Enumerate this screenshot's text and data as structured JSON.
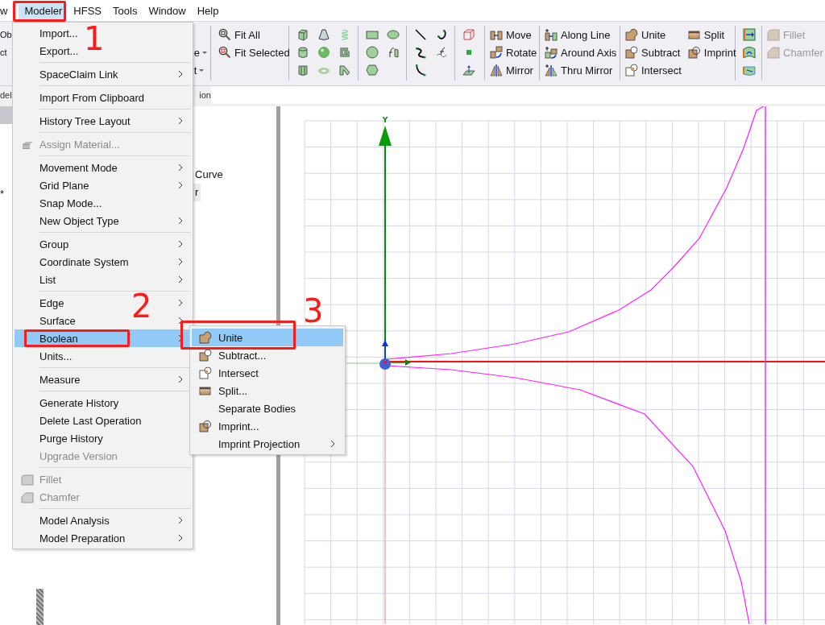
{
  "menubar": [
    {
      "label": "w",
      "selected": false
    },
    {
      "label": "Modeler",
      "selected": true
    },
    {
      "label": "HFSS",
      "selected": false
    },
    {
      "label": "Tools",
      "selected": false
    },
    {
      "label": "Window",
      "selected": false
    },
    {
      "label": "Help",
      "selected": false
    }
  ],
  "ribbon": {
    "cut_left": [
      "Ob",
      "ct"
    ],
    "cut_dropdowns": [
      "e",
      "t"
    ],
    "view": [
      "Fit All",
      "Fit Selected"
    ],
    "transform": [
      "Move",
      "Rotate",
      "Mirror"
    ],
    "duplicate": [
      "Along Line",
      "Around Axis",
      "Thru Mirror"
    ],
    "boolean": [
      "Unite",
      "Subtract",
      "Intersect"
    ],
    "boolean_more": [
      "Split",
      "Imprint"
    ],
    "edges": [
      {
        "label": "Fillet",
        "disabled": true
      },
      {
        "label": "Chamfer",
        "disabled": true
      }
    ]
  },
  "group_labels": [
    "del",
    "ion"
  ],
  "tree": {
    "mark": "*",
    "items": [
      "Curve",
      "r"
    ]
  },
  "menu": {
    "items": [
      {
        "kind": "plain",
        "label": "Import...",
        "submenu": false,
        "disabled": false,
        "selected": false
      },
      {
        "kind": "plain",
        "label": "Export...",
        "submenu": false,
        "disabled": false,
        "selected": false
      },
      {
        "kind": "separator"
      },
      {
        "kind": "plain",
        "label": "SpaceClaim Link",
        "submenu": true,
        "disabled": false,
        "selected": false
      },
      {
        "kind": "separator"
      },
      {
        "kind": "plain",
        "label": "Import From Clipboard",
        "submenu": false,
        "disabled": false,
        "selected": false
      },
      {
        "kind": "separator"
      },
      {
        "kind": "plain",
        "label": "History Tree Layout",
        "submenu": true,
        "disabled": false,
        "selected": false
      },
      {
        "kind": "separator"
      },
      {
        "kind": "material",
        "label": "Assign Material...",
        "submenu": false,
        "disabled": true,
        "selected": false
      },
      {
        "kind": "separator"
      },
      {
        "kind": "plain",
        "label": "Movement Mode",
        "submenu": true,
        "disabled": false,
        "selected": false
      },
      {
        "kind": "plain",
        "label": "Grid Plane",
        "submenu": true,
        "disabled": false,
        "selected": false
      },
      {
        "kind": "plain",
        "label": "Snap Mode...",
        "submenu": false,
        "disabled": false,
        "selected": false
      },
      {
        "kind": "plain",
        "label": "New Object Type",
        "submenu": true,
        "disabled": false,
        "selected": false
      },
      {
        "kind": "separator"
      },
      {
        "kind": "plain",
        "label": "Group",
        "submenu": true,
        "disabled": false,
        "selected": false
      },
      {
        "kind": "plain",
        "label": "Coordinate System",
        "submenu": true,
        "disabled": false,
        "selected": false
      },
      {
        "kind": "plain",
        "label": "List",
        "submenu": true,
        "disabled": false,
        "selected": false
      },
      {
        "kind": "separator"
      },
      {
        "kind": "plain",
        "label": "Edge",
        "submenu": true,
        "disabled": false,
        "selected": false
      },
      {
        "kind": "plain",
        "label": "Surface",
        "submenu": true,
        "disabled": false,
        "selected": false
      },
      {
        "kind": "plain",
        "label": "Boolean",
        "submenu": true,
        "disabled": false,
        "selected": true
      },
      {
        "kind": "plain",
        "label": "Units...",
        "submenu": false,
        "disabled": false,
        "selected": false
      },
      {
        "kind": "separator"
      },
      {
        "kind": "plain",
        "label": "Measure",
        "submenu": true,
        "disabled": false,
        "selected": false
      },
      {
        "kind": "separator"
      },
      {
        "kind": "plain",
        "label": "Generate History",
        "submenu": false,
        "disabled": false,
        "selected": false
      },
      {
        "kind": "plain",
        "label": "Delete Last Operation",
        "submenu": false,
        "disabled": false,
        "selected": false
      },
      {
        "kind": "plain",
        "label": "Purge History",
        "submenu": false,
        "disabled": false,
        "selected": false
      },
      {
        "kind": "plain",
        "label": "Upgrade Version",
        "submenu": false,
        "disabled": true,
        "selected": false
      },
      {
        "kind": "separator"
      },
      {
        "kind": "fillet",
        "label": "Fillet",
        "submenu": false,
        "disabled": true,
        "selected": false
      },
      {
        "kind": "chamfer",
        "label": "Chamfer",
        "submenu": false,
        "disabled": true,
        "selected": false
      },
      {
        "kind": "separator"
      },
      {
        "kind": "plain",
        "label": "Model Analysis",
        "submenu": true,
        "disabled": false,
        "selected": false
      },
      {
        "kind": "plain",
        "label": "Model Preparation",
        "submenu": true,
        "disabled": false,
        "selected": false
      }
    ]
  },
  "submenu": {
    "items": [
      {
        "kind": "unite",
        "label": "Unite",
        "submenu": false,
        "selected": true
      },
      {
        "kind": "subtract",
        "label": "Subtract...",
        "submenu": false,
        "selected": false
      },
      {
        "kind": "intersect",
        "label": "Intersect",
        "submenu": false,
        "selected": false
      },
      {
        "kind": "split",
        "label": "Split...",
        "submenu": false,
        "selected": false
      },
      {
        "kind": "plain",
        "label": "Separate Bodies",
        "submenu": false,
        "selected": false
      },
      {
        "kind": "imprint",
        "label": "Imprint...",
        "submenu": false,
        "selected": false
      },
      {
        "kind": "plain",
        "label": "Imprint Projection",
        "submenu": true,
        "selected": false
      }
    ]
  },
  "viewport": {
    "axis_label": "Y"
  },
  "annotations": [
    {
      "label": "1"
    },
    {
      "label": "2"
    },
    {
      "label": "3"
    }
  ]
}
